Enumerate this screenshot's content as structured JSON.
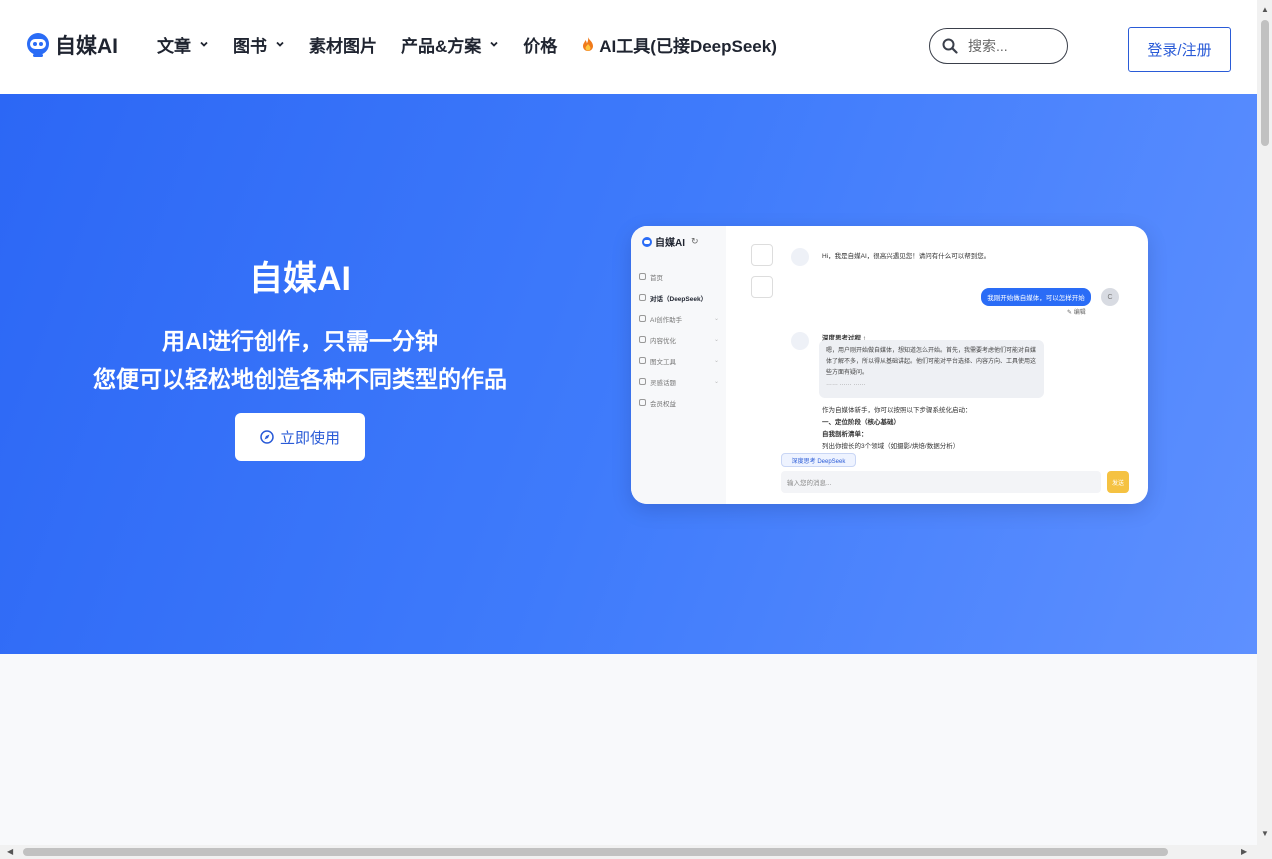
{
  "brand": {
    "name": "自媒AI"
  },
  "nav": {
    "items": [
      {
        "label": "文章",
        "has_dropdown": true
      },
      {
        "label": "图书",
        "has_dropdown": true
      },
      {
        "label": "素材图片",
        "has_dropdown": false
      },
      {
        "label": "产品&方案",
        "has_dropdown": true
      },
      {
        "label": "价格",
        "has_dropdown": false
      },
      {
        "label": "AI工具(已接DeepSeek)",
        "has_dropdown": false,
        "icon": "fire-icon"
      }
    ]
  },
  "search": {
    "placeholder": "搜索..."
  },
  "auth": {
    "login_label": "登录/注册"
  },
  "hero": {
    "title": "自媒AI",
    "subtitle_line1": "用AI进行创作，只需一分钟",
    "subtitle_line2": "您便可以轻松地创造各种不同类型的作品",
    "cta_label": "立即使用",
    "cta_icon": "compass-icon"
  },
  "preview": {
    "logo": "自媒AI",
    "menu": [
      {
        "label": "首页",
        "expandable": false
      },
      {
        "label": "对话（DeepSeek）",
        "expandable": false,
        "active": true
      },
      {
        "label": "AI创作助手",
        "expandable": true
      },
      {
        "label": "内容优化",
        "expandable": true
      },
      {
        "label": "图文工具",
        "expandable": true
      },
      {
        "label": "灵感话题",
        "expandable": true
      },
      {
        "label": "会员权益",
        "expandable": false
      }
    ],
    "greeting": "Hi，我是自媒AI，很高兴遇见您！请问有什么可以帮到您。",
    "user_message": "我刚开始做自媒体，可以怎样开始",
    "user_avatar": "C",
    "edit_label": "编辑",
    "think_title": "深度思考过程",
    "think_text": "嗯，用户刚开始做自媒体，想知道怎么开始。首先，我需要考虑他们可能对自媒体了解不多，所以得从基础讲起。他们可能对平台选择、内容方向、工具使用这些方面有疑问。",
    "think_ellipsis": "…… …… ……",
    "answer_lines": [
      "作为自媒体新手，你可以按照以下步骤系统化启动：",
      "一、定位阶段（核心基础）",
      "自我剖析清单：",
      "列出你擅长的3个领域（如摄影/烘焙/数据分析）"
    ],
    "deep_think_label": "深度思考 DeepSeek",
    "input_placeholder": "输入您的消息...",
    "send_label": "发送"
  }
}
